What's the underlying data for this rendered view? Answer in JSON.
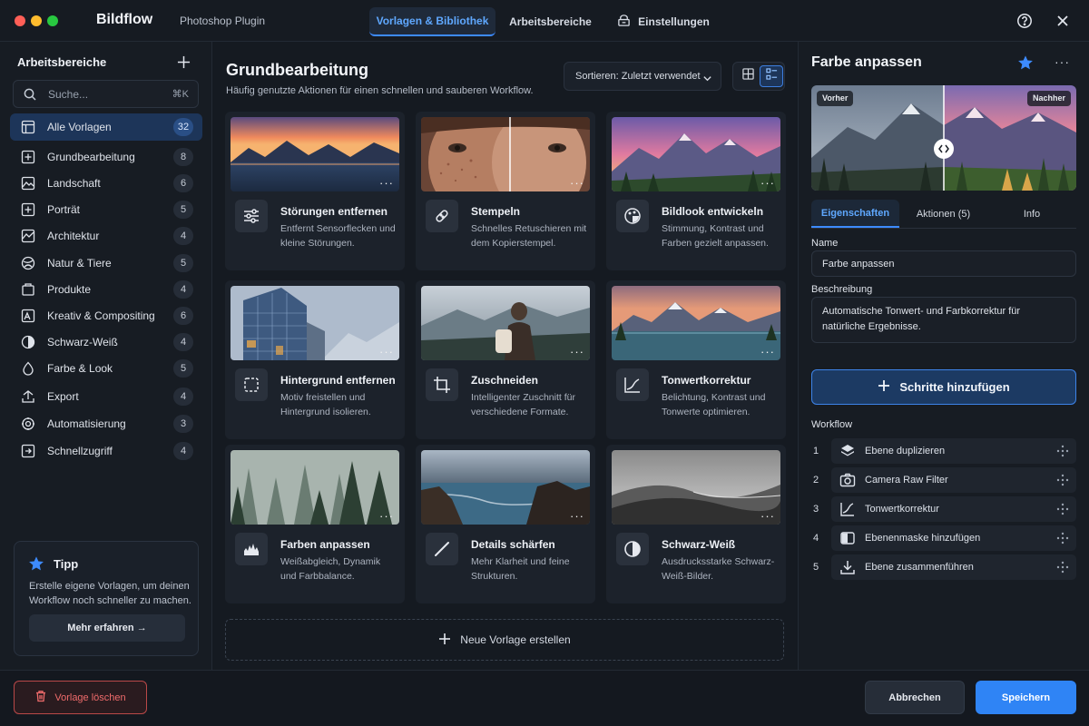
{
  "app": {
    "brand": "Bildflow",
    "subtitle": "Photoshop Plugin",
    "tabs": [
      {
        "label": "Vorlagen & Bibliothek",
        "active": true
      },
      {
        "label": "Arbeitsbereiche",
        "active": false
      },
      {
        "label": "Einstellungen",
        "active": false
      }
    ],
    "icons": {
      "help": "help-circle-icon",
      "close": "close-icon",
      "settings": "gear-box-icon"
    }
  },
  "sidebar": {
    "title": "Arbeitsbereiche",
    "search": {
      "placeholder": "Suche...",
      "shortcut": "⌘K"
    },
    "items": [
      {
        "label": "Alle Vorlagen",
        "count": "32",
        "icon": "templates-icon",
        "active": true
      },
      {
        "label": "Grundbearbeitung",
        "count": "8",
        "icon": "plus-square-icon"
      },
      {
        "label": "Landschaft",
        "count": "6",
        "icon": "landscape-icon"
      },
      {
        "label": "Porträt",
        "count": "5",
        "icon": "portrait-icon"
      },
      {
        "label": "Architektur",
        "count": "4",
        "icon": "architecture-icon"
      },
      {
        "label": "Natur & Tiere",
        "count": "5",
        "icon": "nature-icon"
      },
      {
        "label": "Produkte",
        "count": "4",
        "icon": "box-icon"
      },
      {
        "label": "Kreativ & Compositing",
        "count": "6",
        "icon": "creative-icon"
      },
      {
        "label": "Schwarz-Weiß",
        "count": "4",
        "icon": "bw-icon"
      },
      {
        "label": "Farbe & Look",
        "count": "5",
        "icon": "color-icon"
      },
      {
        "label": "Export",
        "count": "4",
        "icon": "export-icon"
      },
      {
        "label": "Automatisierung",
        "count": "3",
        "icon": "automation-icon"
      },
      {
        "label": "Schnellzugriff",
        "count": "4",
        "icon": "shortcut-icon"
      }
    ],
    "tip": {
      "title": "Tipp",
      "text": "Erstelle eigene Vorlagen, um deinen Workflow noch schneller zu machen.",
      "button": "Mehr erfahren →"
    }
  },
  "main": {
    "title": "Grundbearbeitung",
    "subtitle": "Häufig genutzte Aktionen für einen schnellen und sauberen Workflow.",
    "sort_label": "Sortieren: Zuletzt verwendet",
    "more": "···",
    "cards": [
      {
        "name": "Störungen entfernen",
        "desc": "Entfernt Sensorflecken und kleine Störungen.",
        "icon": "sliders-icon",
        "thumb": "sunset-lake"
      },
      {
        "name": "Stempeln",
        "desc": "Schnelles Retuschieren mit dem Kopierstempel.",
        "icon": "bandage-icon",
        "thumb": "portrait"
      },
      {
        "name": "Bildlook entwickeln",
        "desc": "Stimmung, Kontrast und Farben gezielt anpassen.",
        "icon": "palette-icon",
        "thumb": "mountain-forest"
      },
      {
        "name": "Hintergrund entfernen",
        "desc": "Motiv freistellen und Hintergrund isolieren.",
        "icon": "selection-icon",
        "thumb": "architecture"
      },
      {
        "name": "Zuschneiden",
        "desc": "Intelligenter Zuschnitt für verschiedene Formate.",
        "icon": "crop-icon",
        "thumb": "hiker"
      },
      {
        "name": "Tonwertkorrektur",
        "desc": "Belichtung, Kontrast und Tonwerte optimieren.",
        "icon": "curve-icon",
        "thumb": "mountain-lake"
      },
      {
        "name": "Farben anpassen",
        "desc": "Weißabgleich, Dynamik und Farbbalance.",
        "icon": "levels-icon",
        "thumb": "misty-forest"
      },
      {
        "name": "Details schärfen",
        "desc": "Mehr Klarheit und feine Strukturen.",
        "icon": "sharpen-icon",
        "thumb": "coast"
      },
      {
        "name": "Schwarz-Weiß",
        "desc": "Ausdrucksstarke Schwarz-Weiß-Bilder.",
        "icon": "half-circle-icon",
        "thumb": "dunes"
      }
    ],
    "new_template": "Neue Vorlage erstellen"
  },
  "panel": {
    "title": "Farbe anpassen",
    "before": "Vorher",
    "after": "Nachher",
    "tabs": [
      {
        "label": "Eigenschaften",
        "active": true
      },
      {
        "label": "Aktionen (5)",
        "active": false
      },
      {
        "label": "Info",
        "active": false
      }
    ],
    "name_label": "Name",
    "name_value": "Farbe anpassen",
    "desc_label": "Beschreibung",
    "desc_value": "Automatische Tonwert- und Farbkorrektur für natürliche Ergebnisse.",
    "add_steps": "Schritte hinzufügen",
    "workflow_label": "Workflow",
    "workflow": [
      {
        "n": "1",
        "label": "Ebene duplizieren",
        "icon": "layers-icon"
      },
      {
        "n": "2",
        "label": "Camera Raw Filter",
        "icon": "camera-icon"
      },
      {
        "n": "3",
        "label": "Tonwertkorrektur",
        "icon": "curve-icon"
      },
      {
        "n": "4",
        "label": "Ebenenmaske hinzufügen",
        "icon": "mask-icon"
      },
      {
        "n": "5",
        "label": "Ebene zusammenführen",
        "icon": "merge-icon"
      }
    ]
  },
  "footer": {
    "delete": "Vorlage löschen",
    "cancel": "Abbrechen",
    "save": "Speichern"
  },
  "colors": {
    "accent": "#2f84f5",
    "danger": "#ef6b6b",
    "background": "#13171e"
  }
}
